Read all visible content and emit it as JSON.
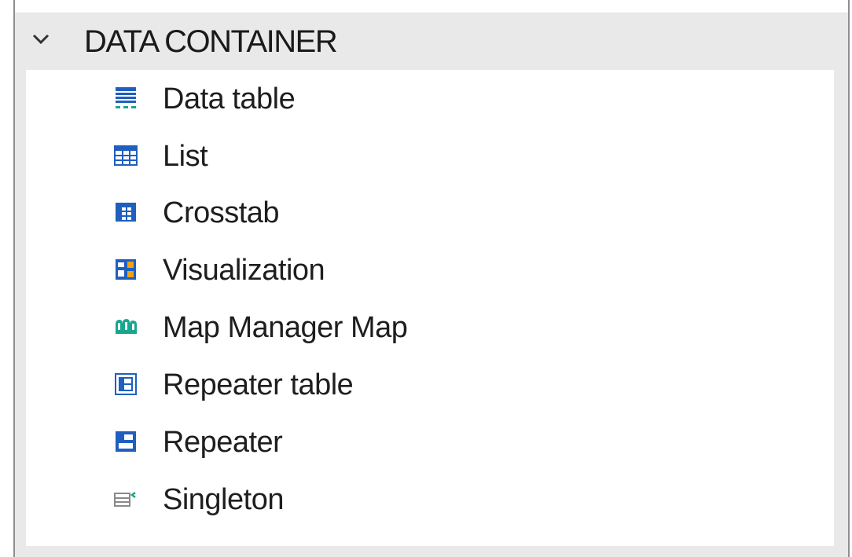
{
  "section": {
    "title": "DATA CONTAINER",
    "expanded": true,
    "toggle_icon": "chevron-down-icon"
  },
  "items": [
    {
      "label": "Data table",
      "icon": "data-table-icon"
    },
    {
      "label": "List",
      "icon": "list-icon"
    },
    {
      "label": "Crosstab",
      "icon": "crosstab-icon"
    },
    {
      "label": "Visualization",
      "icon": "visualization-icon"
    },
    {
      "label": "Map Manager Map",
      "icon": "map-icon"
    },
    {
      "label": "Repeater table",
      "icon": "repeater-table-icon"
    },
    {
      "label": "Repeater",
      "icon": "repeater-icon"
    },
    {
      "label": "Singleton",
      "icon": "singleton-icon"
    }
  ],
  "colors": {
    "icon_blue": "#1f5fbf",
    "icon_teal": "#1aa58f",
    "icon_orange": "#f2a20c",
    "header_bg": "#e9e9e9"
  }
}
